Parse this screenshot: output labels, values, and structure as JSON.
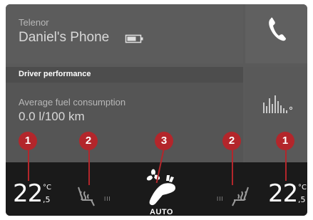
{
  "phone": {
    "carrier": "Telenor",
    "device_name": "Daniel's Phone",
    "icons": {
      "battery": "battery-icon",
      "call": "phone-handset-icon"
    }
  },
  "driver_performance": {
    "header": "Driver performance",
    "label": "Average fuel consumption",
    "value": "0.0 l/100 km",
    "icon": "bar-chart-icon"
  },
  "climate": {
    "left_temp": {
      "whole": "22",
      "decimal": ",5",
      "unit": "°C"
    },
    "right_temp": {
      "whole": "22",
      "decimal": ",5",
      "unit": "°C"
    },
    "auto_label": "AUTO",
    "left_seat_heat_level": "III",
    "right_seat_heat_level": "III",
    "icons": {
      "fan": "fan-icon",
      "seat_heat_left": "seat-heater-left-icon",
      "seat_heat_right": "seat-heater-right-icon",
      "auto_climate": "auto-climate-icon"
    }
  },
  "callouts": [
    "1",
    "2",
    "3",
    "2",
    "1"
  ],
  "colors": {
    "callout": "#b3262b",
    "climate_bar": "#1a1a1a",
    "panel": "#5a5a5a"
  }
}
